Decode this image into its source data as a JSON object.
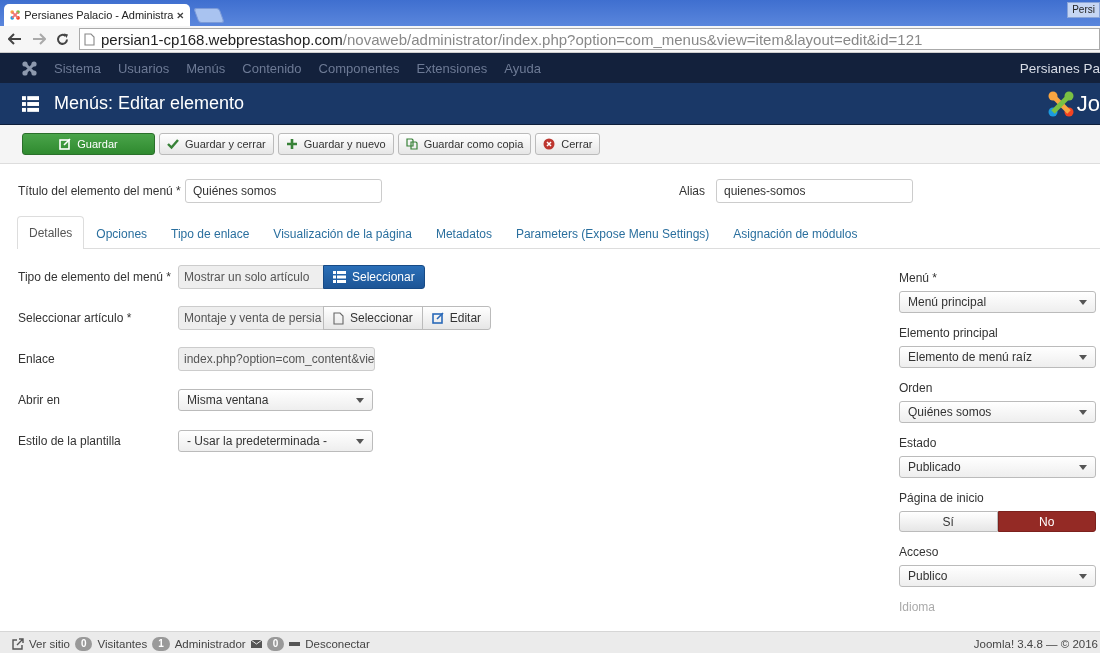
{
  "browser": {
    "tab_title": "Persianes Palacio - Administra",
    "corner_label": "Persi",
    "address_host": "persian1-cp168.webprestashop.com",
    "address_path": "/novaweb/administrator/index.php?option=com_menus&view=item&layout=edit&id=121"
  },
  "nav": {
    "items": [
      "Sistema",
      "Usuarios",
      "Menús",
      "Contenido",
      "Componentes",
      "Extensiones",
      "Ayuda"
    ],
    "site_name": "Persianes Pa"
  },
  "header": {
    "title": "Menús: Editar elemento",
    "logo_text": "Jo"
  },
  "toolbar": [
    {
      "label": "Guardar",
      "kind": "primary"
    },
    {
      "label": "Guardar y cerrar",
      "kind": "default"
    },
    {
      "label": "Guardar y nuevo",
      "kind": "default"
    },
    {
      "label": "Guardar como copia",
      "kind": "default"
    },
    {
      "label": "Cerrar",
      "kind": "default"
    }
  ],
  "title_field": {
    "label": "Título del elemento del menú *",
    "value": "Quiénes somos"
  },
  "alias_field": {
    "label": "Alias",
    "value": "quienes-somos"
  },
  "tabs": [
    {
      "label": "Detalles",
      "selected": true
    },
    {
      "label": "Opciones",
      "selected": false
    },
    {
      "label": "Tipo de enlace",
      "selected": false
    },
    {
      "label": "Visualización de la página",
      "selected": false
    },
    {
      "label": "Metadatos",
      "selected": false
    },
    {
      "label": "Parameters (Expose Menu Settings)",
      "selected": false
    },
    {
      "label": "Asignación de módulos",
      "selected": false
    }
  ],
  "details": [
    {
      "kind": "picker",
      "label": "Tipo de elemento del menú *",
      "value": "Mostrar un solo artículo",
      "buttons": [
        {
          "label": "Seleccionar",
          "kind": "primary"
        }
      ]
    },
    {
      "kind": "picker",
      "label": "Seleccionar artículo *",
      "value": "Montaje y venta de persia",
      "buttons": [
        {
          "label": "Seleccionar",
          "kind": "default"
        },
        {
          "label": "Editar",
          "kind": "default"
        }
      ]
    },
    {
      "kind": "readonly",
      "label": "Enlace",
      "value": "index.php?option=com_content&vie"
    },
    {
      "kind": "select",
      "label": "Abrir en",
      "value": "Misma ventana"
    },
    {
      "kind": "select",
      "label": "Estilo de la plantilla",
      "value": "- Usar la predeterminada -"
    }
  ],
  "sidebar": [
    {
      "kind": "select",
      "label": "Menú *",
      "value": "Menú principal"
    },
    {
      "kind": "select",
      "label": "Elemento principal",
      "value": "Elemento de menú raíz"
    },
    {
      "kind": "select",
      "label": "Orden",
      "value": "Quiénes somos"
    },
    {
      "kind": "select",
      "label": "Estado",
      "value": "Publicado"
    },
    {
      "kind": "toggle",
      "label": "Página de inicio",
      "options": [
        {
          "label": "Sí",
          "selected": false
        },
        {
          "label": "No",
          "selected": true
        }
      ]
    },
    {
      "kind": "select",
      "label": "Acceso",
      "value": "Publico"
    },
    {
      "kind": "heading",
      "label": "Idioma"
    }
  ],
  "status_bar": {
    "view_site": "Ver sitio",
    "visitors_count": "0",
    "visitors": "Visitantes",
    "admins_count": "1",
    "admins": "Administrador",
    "messages_count": "0",
    "logout": "Desconectar",
    "version": "Joomla! 3.4.8 — © 2016"
  }
}
